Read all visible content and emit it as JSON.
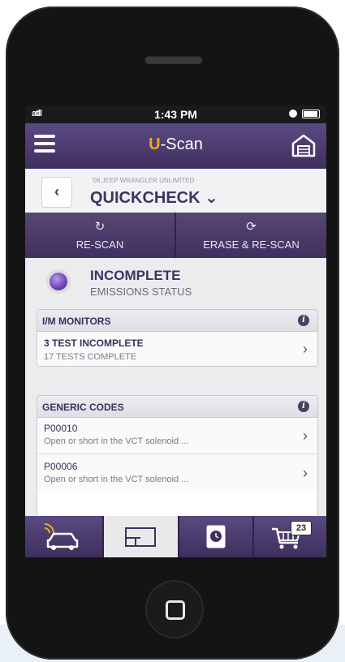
{
  "status_bar": {
    "signal": "atll",
    "time": "1:43 PM"
  },
  "app": {
    "title_accent": "U",
    "title_rest": "-Scan"
  },
  "vehicle": {
    "name": "'08 JEEP WRANGLER UNLIMITED",
    "screen": "QUICKCHECK",
    "back_glyph": "‹",
    "dropdown_glyph": "⌄"
  },
  "actions": [
    {
      "label": "RE-SCAN",
      "icon": "refresh-icon",
      "glyph": "↻"
    },
    {
      "label": "ERASE & RE-SCAN",
      "icon": "erase-refresh-icon",
      "glyph": "⟳"
    }
  ],
  "emissions": {
    "status": "INCOMPLETE",
    "label": "EMISSIONS STATUS",
    "dot_color": "#6b41b5"
  },
  "im_monitors": {
    "header": "I/M MONITORS",
    "info_glyph": "i",
    "rows": [
      {
        "title": "3 TEST INCOMPLETE",
        "subtitle": "17 TESTS COMPLETE"
      }
    ]
  },
  "generic_codes": {
    "header": "GENERIC CODES",
    "info_glyph": "i",
    "rows": [
      {
        "code": "P00010",
        "description": "Open or short in the VCT solenoid ..."
      },
      {
        "code": "P00006",
        "description": "Open or short in the VCT solenoid ..."
      }
    ]
  },
  "chevron_glyph": "›",
  "tabs": [
    {
      "name": "vehicle-tab",
      "icon": "car-wifi-icon",
      "active": false
    },
    {
      "name": "dashboard-tab",
      "icon": "dashboard-icon",
      "active": true
    },
    {
      "name": "history-tab",
      "icon": "history-book-icon",
      "active": false
    },
    {
      "name": "shop-tab",
      "icon": "cart-icon",
      "active": false,
      "badge": "23"
    }
  ],
  "colors": {
    "brand_purple": "#3e2f60",
    "accent_orange": "#f1a81d"
  }
}
